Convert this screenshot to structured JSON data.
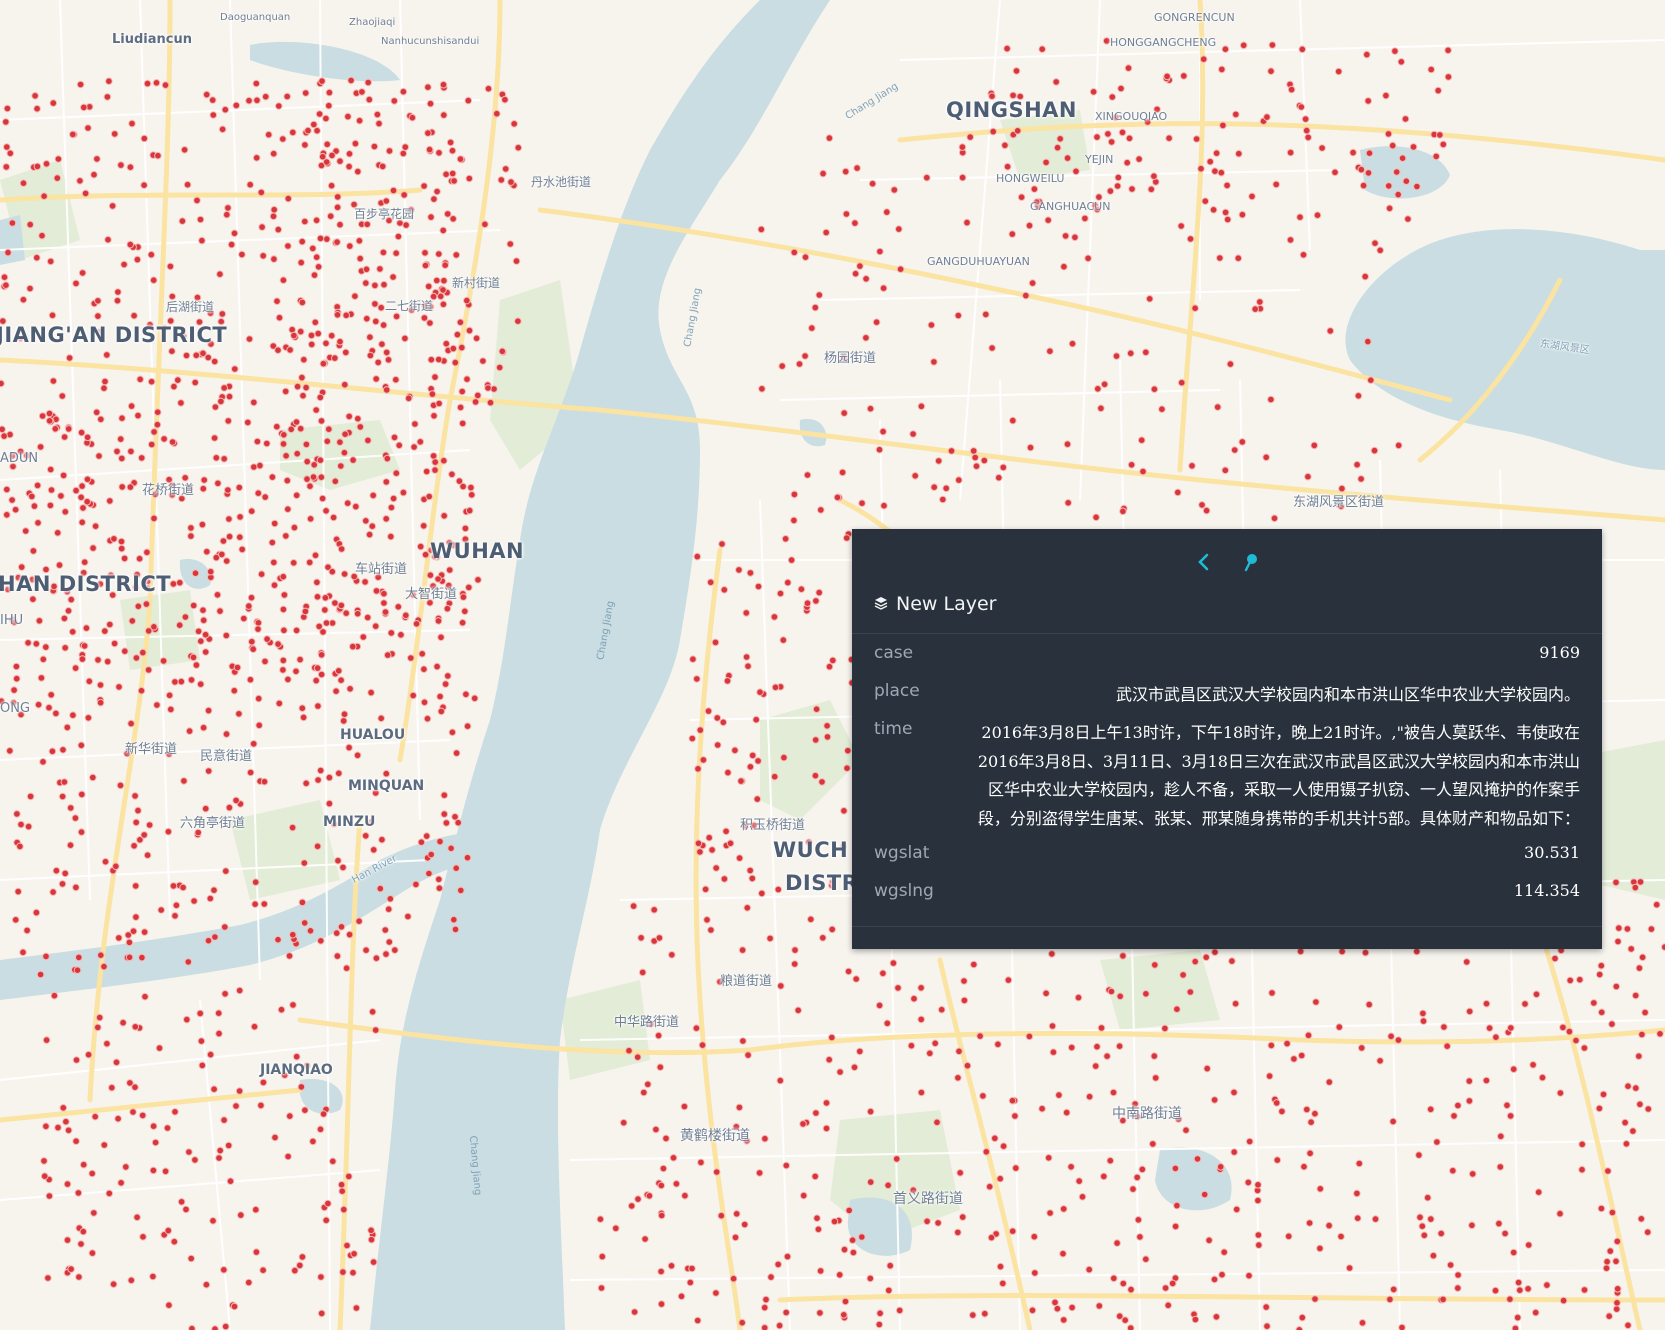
{
  "map_labels": {
    "liudiancun": "Liudiancun",
    "daoguanquan": "Daoguanquan",
    "zhaojiaqi": "Zhaojiaqi",
    "nanhucunshisandui": "Nanhucunshisandui",
    "dansuichi": "丹水池街道",
    "baibutinghuayuan": "百步亭花园",
    "xincun": "新村街道",
    "erqi": "二七街道",
    "houhu": "后湖街道",
    "jiangan_district": "JIANG'AN DISTRICT",
    "adun": "ADUN",
    "huaqiao": "花桥街道",
    "wuhan": "WUHAN",
    "chezhan": "车站街道",
    "dazhi": "大智街道",
    "han_district": "HAN DISTRICT",
    "ihu": "IHU",
    "ong": "ONG",
    "xinhua": "新华街道",
    "minyi": "民意街道",
    "hualou": "HUALOU",
    "minquan": "MINQUAN",
    "liujiaoting": "六角亭街道",
    "minzu": "MINZU",
    "han_river": "Han River",
    "jianqiao": "JIANQIAO",
    "qingshan": "QINGSHAN",
    "gongrencun": "GONGRENCUN",
    "honggangcheng": "HONGGANGCHENG",
    "xingouqiao": "XINGOUQIAO",
    "yejin": "YEJIN",
    "hongweilu": "HONGWEILU",
    "ganghuacun": "GANGHUACUN",
    "gangduhuayuan": "GANGDUHUAYUAN",
    "yangyuan": "杨园街道",
    "donghu_fengjing": "东湖风景区街道",
    "jiyuqiao": "积玉桥街道",
    "wuchang_a": "WUCH",
    "wuchang_b": "DISTR",
    "liangdao": "粮道街道",
    "zhonghualu": "中华路街道",
    "huanghelou": "黄鹤楼街道",
    "zhongnanlu": "中南路街道",
    "shouyilu": "首义路街道",
    "chang_jiang_1": "Chang Jiang",
    "chang_jiang_2": "Chang Jiang",
    "chang_jiang_3": "Chang Jiang",
    "chang_jiang_4": "Chang Jiang",
    "donghu": "东湖风景区"
  },
  "popup": {
    "layer_name": "New Layer",
    "fields": [
      {
        "key": "case",
        "value": "9169"
      },
      {
        "key": "place",
        "value": "武汉市武昌区武汉大学校园内和本市洪山区华中农业大学校园内。"
      },
      {
        "key": "time",
        "value": "2016年3月8日上午13时许，下午18时许，晚上21时许。,\"被告人莫跃华、韦使政在2016年3月8日、3月11日、3月18日三次在武汉市武昌区武汉大学校园内和本市洪山区华中农业大学校园内，趁人不备，采取一人使用镊子扒窃、一人望风掩护的作案手段，分别盗得学生唐某、张某、邢某随身携带的手机共计5部。具体财产和物品如下："
      },
      {
        "key": "wgslat",
        "value": "30.531"
      },
      {
        "key": "wgslng",
        "value": "114.354"
      }
    ]
  },
  "colors": {
    "land": "#f7f4ee",
    "water": "#c9dde2",
    "park": "#e3ecd6",
    "road_major": "#fbe3a2",
    "road_minor": "#ffffff",
    "point": "#d8363a",
    "popup_bg": "#29323c",
    "accent": "#1fbad6"
  },
  "icons": {
    "prev": "chevron-left-icon",
    "pin": "map-pin-icon",
    "layer": "layers-icon"
  }
}
